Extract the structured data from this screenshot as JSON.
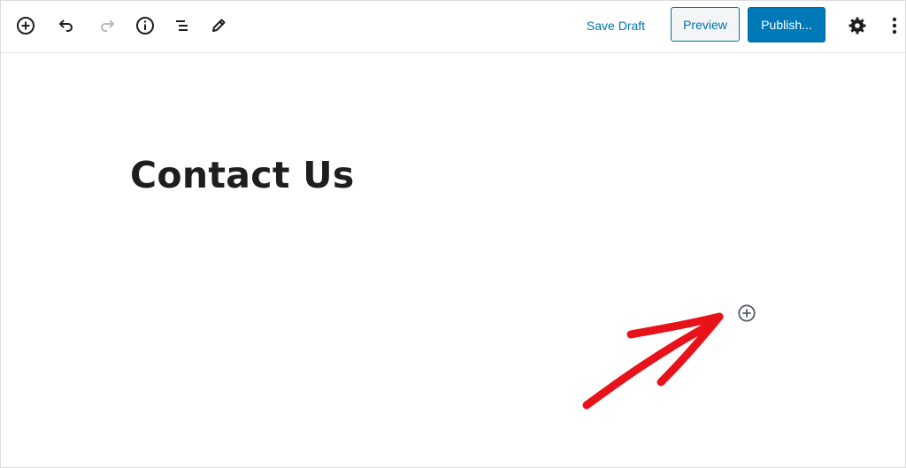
{
  "toolbar": {
    "left_icons": [
      "add-block-icon",
      "undo-icon",
      "redo-icon",
      "info-icon",
      "list-view-icon",
      "edit-icon"
    ],
    "save_draft_label": "Save Draft",
    "preview_label": "Preview",
    "publish_label": "Publish...",
    "right_icons": [
      "gear-icon",
      "more-options-icon"
    ]
  },
  "post": {
    "title": "Contact Us"
  },
  "colors": {
    "accent": "#0073aa",
    "publish_bg": "#0079b8",
    "annotation_arrow": "#e8131a"
  }
}
